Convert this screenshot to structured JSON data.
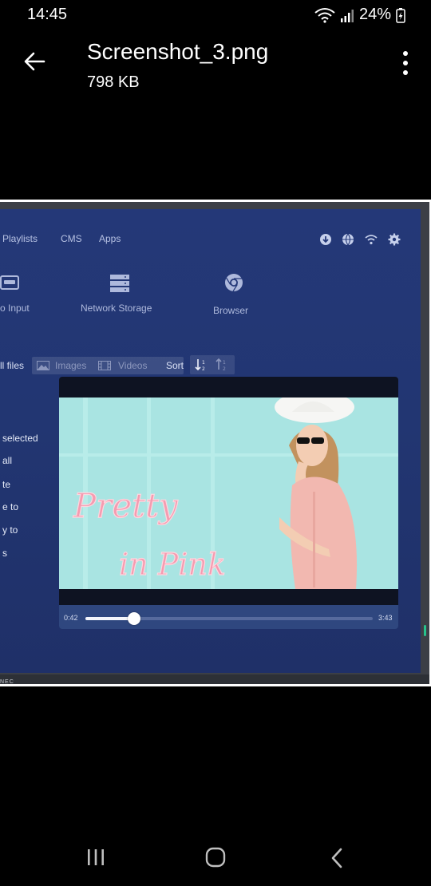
{
  "status_bar": {
    "time": "14:45",
    "battery": "24%"
  },
  "app_bar": {
    "title": "Screenshot_3.png",
    "subtitle": "798 KB"
  },
  "screen": {
    "top_nav": [
      "Playlists",
      "CMS",
      "Apps"
    ],
    "sources": [
      "o Input",
      "Network Storage",
      "Browser"
    ],
    "filters": {
      "all": "ll files",
      "images": "Images",
      "videos": "Videos",
      "sort": "Sort"
    },
    "side_menu": [
      "selected",
      "all",
      "te",
      "e to",
      "y to",
      "s"
    ],
    "video": {
      "overlay_line1": "Pretty",
      "overlay_line2": "in Pink"
    },
    "player": {
      "current_time": "0:42",
      "total_time": "3:43",
      "progress": 0.17
    },
    "brand": "NEC"
  },
  "colors": {
    "screen_bg": "#243878",
    "video_bg": "#a8e3e1",
    "accent_pink": "#f59bb0"
  }
}
